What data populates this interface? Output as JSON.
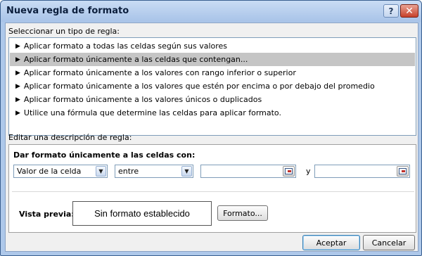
{
  "window": {
    "title": "Nueva regla de formato",
    "help_label": "?",
    "close_label": "✕"
  },
  "rule_type": {
    "label": "Seleccionar un tipo de regla:",
    "items": [
      {
        "label": "Aplicar formato a todas las celdas según sus valores",
        "selected": false
      },
      {
        "label": "Aplicar formato únicamente a las celdas que contengan...",
        "selected": true
      },
      {
        "label": "Aplicar formato únicamente a los valores con rango inferior o superior",
        "selected": false
      },
      {
        "label": "Aplicar formato únicamente a los valores que estén por encima o por debajo del promedio",
        "selected": false
      },
      {
        "label": "Aplicar formato únicamente a los valores únicos o duplicados",
        "selected": false
      },
      {
        "label": "Utilice una fórmula que determine las celdas para aplicar formato.",
        "selected": false
      }
    ]
  },
  "description": {
    "label": "Editar una descripción de regla:",
    "title": "Dar formato únicamente a las celdas con:",
    "condition_select": "Valor de la celda",
    "operator_select": "entre",
    "value1": "",
    "and_label": "y",
    "value2": ""
  },
  "preview": {
    "label": "Vista previa:",
    "sample_text": "Sin formato establecido",
    "format_button": "Formato..."
  },
  "footer": {
    "accept_label": "Aceptar",
    "cancel_label": "Cancelar"
  },
  "icons": {
    "rule_bullet": "triangle-right-icon",
    "dropdown": "chevron-down-icon",
    "range_select": "collapse-dialog-icon"
  },
  "colors": {
    "title_bar": "#aec8ea",
    "selected_row": "#c5c5c5",
    "close_button": "#c7412b"
  }
}
